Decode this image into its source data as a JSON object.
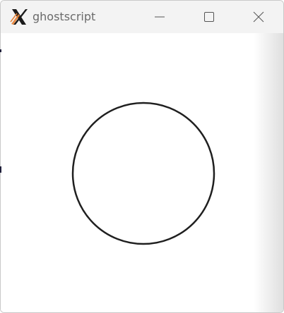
{
  "window": {
    "title": "ghostscript",
    "icon": "x-logo-icon"
  },
  "controls": {
    "minimize_icon": "minimize-icon",
    "maximize_icon": "maximize-icon",
    "close_icon": "close-icon"
  },
  "canvas": {
    "shape": "circle",
    "stroke_color": "#1f1f1f",
    "fill_color": "#ffffff"
  }
}
